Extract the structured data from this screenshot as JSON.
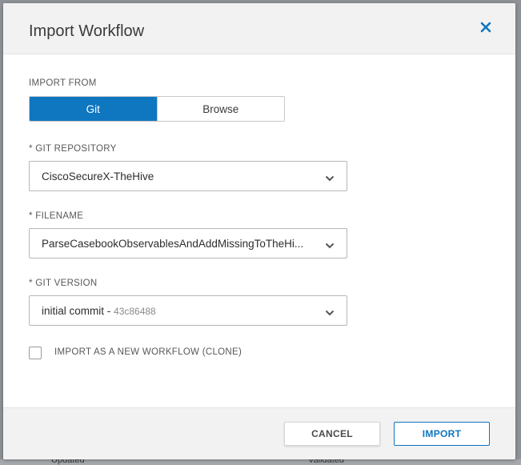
{
  "background": {
    "footer_left_label": "Updated",
    "footer_right_label": "Validated"
  },
  "dialog": {
    "title": "Import Workflow",
    "close_icon": "close-icon",
    "import_from": {
      "label": "IMPORT FROM",
      "options": [
        "Git",
        "Browse"
      ],
      "selected": "Git"
    },
    "git_repository": {
      "label": "* GIT REPOSITORY",
      "value": "CiscoSecureX-TheHive"
    },
    "filename": {
      "label": "* FILENAME",
      "value": "ParseCasebookObservablesAndAddMissingToTheHi..."
    },
    "git_version": {
      "label": "* GIT VERSION",
      "value": "initial commit",
      "separator": " - ",
      "commit": "43c86488"
    },
    "clone_checkbox": {
      "label": "IMPORT AS A NEW WORKFLOW (CLONE)",
      "checked": false
    },
    "buttons": {
      "cancel": "CANCEL",
      "import": "IMPORT"
    }
  },
  "colors": {
    "accent": "#0f76c0",
    "overlay": "#8f9398"
  }
}
